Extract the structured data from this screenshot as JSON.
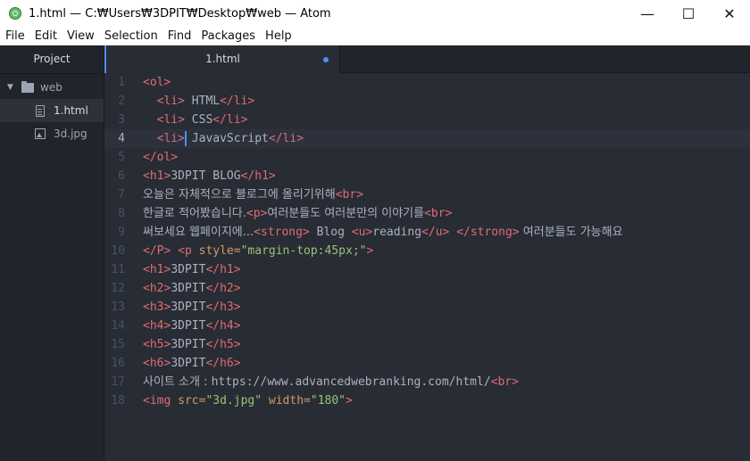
{
  "window": {
    "title": "1.html — C:₩Users₩3DPIT₩Desktop₩web — Atom",
    "controls": {
      "minimize": "—",
      "maximize": "☐",
      "close": "✕"
    }
  },
  "menu": [
    "File",
    "Edit",
    "View",
    "Selection",
    "Find",
    "Packages",
    "Help"
  ],
  "tree": {
    "tab_label": "Project",
    "folder": "web",
    "files": [
      "1.html",
      "3d.jpg"
    ]
  },
  "tab": {
    "label": "1.html",
    "modified": true
  },
  "editor": {
    "cursor_line": 4,
    "lines": [
      {
        "n": "1",
        "segs": [
          [
            "t",
            "<ol>"
          ]
        ]
      },
      {
        "n": "2",
        "segs": [
          [
            "p",
            "  "
          ],
          [
            "t",
            "<li>"
          ],
          [
            "p",
            " HTML"
          ],
          [
            "t",
            "</li>"
          ]
        ]
      },
      {
        "n": "3",
        "segs": [
          [
            "p",
            "  "
          ],
          [
            "t",
            "<li>"
          ],
          [
            "p",
            " CSS"
          ],
          [
            "t",
            "</li>"
          ]
        ]
      },
      {
        "n": "4",
        "segs": [
          [
            "p",
            "  "
          ],
          [
            "t",
            "<li>"
          ],
          [
            "p",
            " JavavScript"
          ],
          [
            "t",
            "</li>"
          ]
        ]
      },
      {
        "n": "5",
        "segs": [
          [
            "t",
            "</ol>"
          ]
        ]
      },
      {
        "n": "6",
        "segs": [
          [
            "t",
            "<h1>"
          ],
          [
            "p",
            "3DPIT BLOG"
          ],
          [
            "t",
            "</h1>"
          ]
        ]
      },
      {
        "n": "7",
        "segs": [
          [
            "k",
            "오늘은 자체적으로 블로그에 올리기위해"
          ],
          [
            "t",
            "<br>"
          ]
        ]
      },
      {
        "n": "8",
        "segs": [
          [
            "k",
            "한글로 적어봤습니다."
          ],
          [
            "t",
            "<p>"
          ],
          [
            "k",
            "여러분들도 여러분만의 이야기를"
          ],
          [
            "t",
            "<br>"
          ]
        ]
      },
      {
        "n": "9",
        "segs": [
          [
            "k",
            "써보세요 웹페이지에..."
          ],
          [
            "t",
            "<strong>"
          ],
          [
            "p",
            " Blog "
          ],
          [
            "t",
            "<u>"
          ],
          [
            "p",
            "reading"
          ],
          [
            "t",
            "</u>"
          ],
          [
            "p",
            " "
          ],
          [
            "t",
            "</strong>"
          ],
          [
            "k",
            " 여러분들도 가능해요"
          ]
        ]
      },
      {
        "n": "10",
        "segs": [
          [
            "t",
            "</P>"
          ],
          [
            "p",
            " "
          ],
          [
            "t",
            "<p "
          ],
          [
            "a",
            "style="
          ],
          [
            "s",
            "\"margin-top:45px;\""
          ],
          [
            "t",
            ">"
          ]
        ]
      },
      {
        "n": "11",
        "segs": [
          [
            "t",
            "<h1>"
          ],
          [
            "p",
            "3DPIT"
          ],
          [
            "t",
            "</h1>"
          ]
        ]
      },
      {
        "n": "12",
        "segs": [
          [
            "t",
            "<h2>"
          ],
          [
            "p",
            "3DPIT"
          ],
          [
            "t",
            "</h2>"
          ]
        ]
      },
      {
        "n": "13",
        "segs": [
          [
            "t",
            "<h3>"
          ],
          [
            "p",
            "3DPIT"
          ],
          [
            "t",
            "</h3>"
          ]
        ]
      },
      {
        "n": "14",
        "segs": [
          [
            "t",
            "<h4>"
          ],
          [
            "p",
            "3DPIT"
          ],
          [
            "t",
            "</h4>"
          ]
        ]
      },
      {
        "n": "15",
        "segs": [
          [
            "t",
            "<h5>"
          ],
          [
            "p",
            "3DPIT"
          ],
          [
            "t",
            "</h5>"
          ]
        ]
      },
      {
        "n": "16",
        "segs": [
          [
            "t",
            "<h6>"
          ],
          [
            "p",
            "3DPIT"
          ],
          [
            "t",
            "</h6>"
          ]
        ]
      },
      {
        "n": "17",
        "segs": [
          [
            "k",
            "사이트 소개 : "
          ],
          [
            "p",
            "https://www.advancedwebranking.com/html/"
          ],
          [
            "t",
            "<br>"
          ]
        ]
      },
      {
        "n": "18",
        "segs": [
          [
            "t",
            "<img "
          ],
          [
            "a",
            "src="
          ],
          [
            "s",
            "\"3d.jpg\""
          ],
          [
            "a",
            " width="
          ],
          [
            "s",
            "\"180\""
          ],
          [
            "t",
            ">"
          ]
        ]
      }
    ]
  }
}
